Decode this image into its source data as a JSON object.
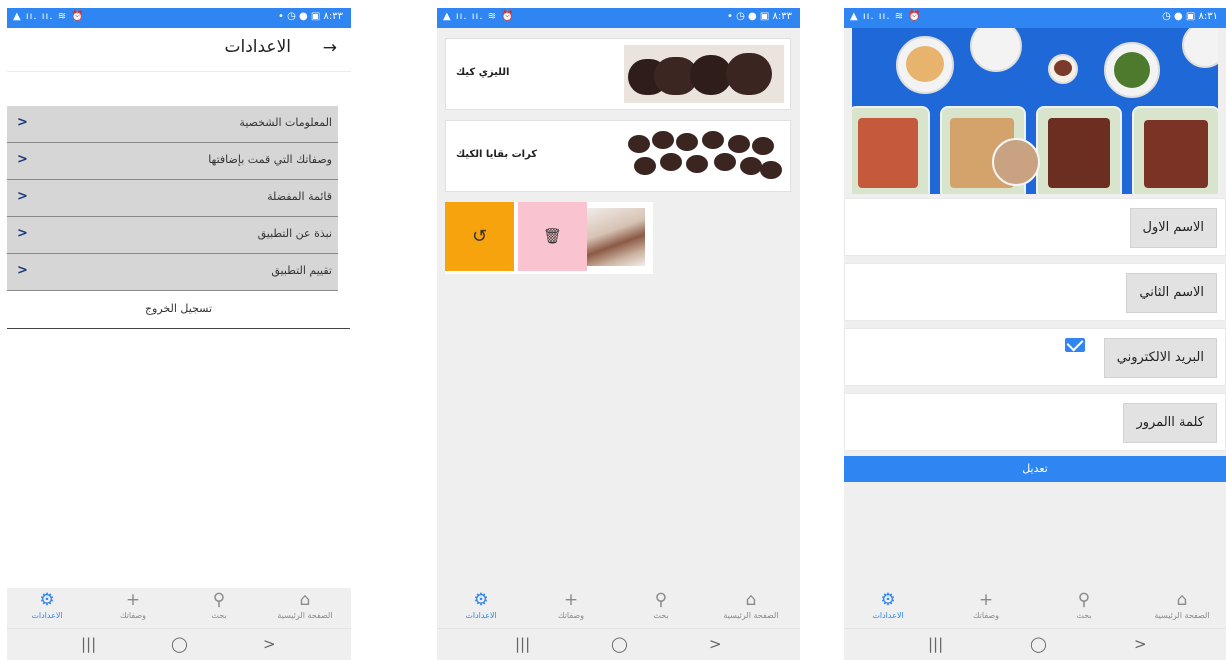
{
  "status": {
    "left_icons": "▲ ıı. ıı. ≋ ⏰",
    "screen1_right": "• ◷ ● ▣ ٨:٣٣",
    "screen2_right": "• ◷ ● ▣ ٨:٣٣",
    "screen3_right": "◷ ● ▣ ٨:٣١"
  },
  "nav": {
    "settings": "الاعدادات",
    "recipes": "وصفاتك",
    "search": "بحث",
    "home": "الصفحة الرئيسية",
    "icons": {
      "settings": "gear-icon",
      "recipes": "plus-icon",
      "search": "search-icon",
      "home": "home-icon"
    },
    "active_color": "#2f86f3"
  },
  "system_nav": {
    "recents": "|||",
    "home": "◯",
    "back": ">"
  },
  "screen1": {
    "title": "الاعدادات",
    "back_arrow": "→",
    "items": [
      {
        "label": "المعلومات الشخصية",
        "chevron": ">"
      },
      {
        "label": "وصفاتك التي قمت بإضافتها",
        "chevron": ">"
      },
      {
        "label": "قائمة المفضلة",
        "chevron": ">"
      },
      {
        "label": "نبذة عن التطبيق",
        "chevron": ">"
      },
      {
        "label": "تقييم التطبيق",
        "chevron": ">"
      }
    ],
    "logout": "تسجيل الخروج"
  },
  "screen2": {
    "recipes": [
      {
        "name": "الليزي كيك"
      },
      {
        "name": "كرات بقايا الكيك"
      }
    ],
    "swipe_actions": {
      "restore_icon": "↺",
      "delete_icon": "🗑",
      "restore_color": "#f7a30e",
      "delete_color": "#f9c3cf"
    }
  },
  "screen3": {
    "fields": [
      {
        "label": "الاسم الاول"
      },
      {
        "label": "الاسم الثاني"
      },
      {
        "label": "البريد الالكتروني",
        "icon": "mail-icon"
      },
      {
        "label": "كلمة االمرور"
      }
    ],
    "edit_button": "تعديل"
  }
}
